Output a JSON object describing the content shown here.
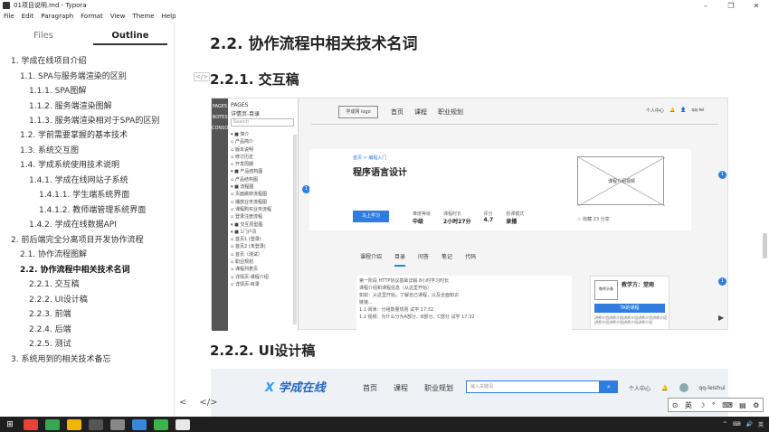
{
  "window": {
    "title": "01项目说明.md - Typora",
    "controls": [
      "–",
      "❐",
      "✕"
    ]
  },
  "menu": [
    "File",
    "Edit",
    "Paragraph",
    "Format",
    "View",
    "Theme",
    "Help"
  ],
  "sidebar": {
    "tabs": [
      "Files",
      "Outline"
    ],
    "active_tab": "Outline",
    "outline": [
      {
        "text": "1. 学成在线项目介绍",
        "level": 1
      },
      {
        "text": "1.1. SPA与服务端渲染的区别",
        "level": 2
      },
      {
        "text": "1.1.1. SPA图解",
        "level": 3
      },
      {
        "text": "1.1.2. 服务端渲染图解",
        "level": 3
      },
      {
        "text": "1.1.3. 服务端渲染相对于SPA的区别",
        "level": 3
      },
      {
        "text": "1.2. 学前需要掌握的基本技术",
        "level": 2
      },
      {
        "text": "1.3. 系统交互图",
        "level": 2
      },
      {
        "text": "1.4. 学成系统使用技术说明",
        "level": 2
      },
      {
        "text": "1.4.1. 学成在线网站子系统",
        "level": 3
      },
      {
        "text": "1.4.1.1. 学生端系统界面",
        "level": 4
      },
      {
        "text": "1.4.1.2. 教师端管理系统界面",
        "level": 4
      },
      {
        "text": "1.4.2. 学成在线数据API",
        "level": 3
      },
      {
        "text": "2. 前后端完全分离项目开发协作流程",
        "level": 1
      },
      {
        "text": "2.1. 协作流程图解",
        "level": 2
      },
      {
        "text": "2.2. 协作流程中相关技术名词",
        "level": 2
      },
      {
        "text": "2.2.1. 交互稿",
        "level": 3
      },
      {
        "text": "2.2.2. UI设计稿",
        "level": 3
      },
      {
        "text": "2.2.3. 前端",
        "level": 3
      },
      {
        "text": "2.2.4. 后端",
        "level": 3
      },
      {
        "text": "2.2.5. 测试",
        "level": 3
      },
      {
        "text": "3. 系统用到的相关技术备忘",
        "level": 1
      }
    ]
  },
  "main": {
    "h2": "2.2. 协作流程中相关技术名词",
    "h3_interaction": "2.2.1. 交互稿",
    "h3_ui": "2.2.2. UI设计稿",
    "code_marker": "</>"
  },
  "wireframe": {
    "pages_label": "PAGES",
    "notes_label": "NOTES",
    "console_label": "CONSOLE",
    "panel_title": "PAGES",
    "panel_sub": "详情页-目录",
    "search_placeholder": "Search",
    "page_tree": [
      "▾ ■ 简介",
      "  ▫ 产品简介",
      "  ▫ 版本说明",
      "  ▫ 修订历史",
      "  ▫ 开发周期",
      "▾ ■ 产品结构图",
      "  ▫ 产品结构图",
      "▾ ■ 流程图",
      "  ▫ 页面跳转流程图",
      "  ▫ 播放业务流程图",
      "  ▫ 课程购买业务流程",
      "  ▫ 登录注册流程",
      "▾ ■ 交互原型图",
      "  ▾ ■ 1门户页",
      "    ▫ 首页1 (登录)",
      "    ▫ 首页2 (未登录)",
      "    ▫ 首页（测试）",
      "    ▫ 职业规划",
      "    ▫ 课程列表页",
      "    ▫ 详情页-课程介绍",
      "    ▫ 详情页-目录"
    ],
    "logo": "学成网 logo",
    "nav": [
      "首页",
      "课程",
      "职业规划"
    ],
    "nav_right": [
      "个人中心",
      "🔔",
      "👤",
      "qq-lei"
    ],
    "breadcrumb": "首页 > 编程入门",
    "course_title": "程序语言设计",
    "learn_button": "马上学习",
    "stats": [
      {
        "label": "难度等级",
        "value": "中级"
      },
      {
        "label": "课程时长",
        "value": "2小时27分"
      },
      {
        "label": "评分",
        "value": "4.7"
      },
      {
        "label": "授课模式",
        "value": "录播"
      }
    ],
    "image_label": "课程介绍视频",
    "share": "☆ 收藏 23   分享",
    "tabs": [
      "课程介绍",
      "目录",
      "问答",
      "笔记",
      "代码"
    ],
    "active_tab": "目录",
    "content_lines": [
      "第一阶段  HTTP协议基础详解                                     8小时学习时长",
      "课程介绍和课程信息（从这里开始）",
      "如如：从这里开始，了解自己课程，以及全面知识",
      "链接...",
      "  1.1 阅读：分组数量规则  试学                             17:32",
      "  1.2 视频：为什么分为A部分、B部分、C部分  试学       17:32"
    ],
    "teacher_name": "教学方：堂雨",
    "teacher_avatar": "教师头像",
    "teacher_button": "TA的课程",
    "teacher_desc": "讲师介绍讲师介绍讲师介绍讲师介绍讲师介绍讲师介绍讲师介绍讲师介绍讲师介绍",
    "dot_label": "1"
  },
  "ui_design": {
    "logo": "学成在线",
    "nav": [
      "首页",
      "课程",
      "职业规划"
    ],
    "search_placeholder": "输入关键词",
    "search_icon": "search-icon",
    "right": [
      "个人中心",
      "🔔",
      "qq-leishui"
    ]
  },
  "bottom_tools": [
    "<",
    "</>"
  ],
  "ime": [
    "⊙",
    "英",
    "☽",
    "°",
    "⌨",
    "▤",
    "⚙"
  ],
  "taskbar": {
    "start": "⊞",
    "tray": [
      "^",
      "⌨",
      "🔊",
      "英"
    ],
    "icon_colors": [
      "#ea4335",
      "#34a853",
      "#f2b600",
      "#555555",
      "#888888",
      "#3a86d8",
      "#3ab54a",
      "#e8e8e8"
    ]
  },
  "colors": {
    "accent": "#2f7de1",
    "ui_logo": "#2466c4"
  }
}
